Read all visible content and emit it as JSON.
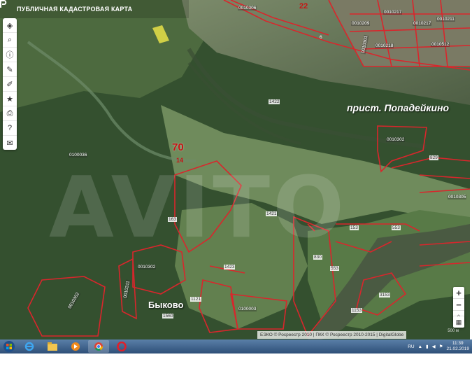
{
  "app": {
    "title": "ПУБЛИЧНАЯ КАДАСТРОВАЯ КАРТА"
  },
  "toolbar": {
    "tools": [
      {
        "name": "layers-icon",
        "glyph": "◈"
      },
      {
        "name": "search-icon",
        "glyph": "⌕"
      },
      {
        "name": "info-icon",
        "glyph": "ⓘ"
      },
      {
        "name": "pencil-icon",
        "glyph": "✎"
      },
      {
        "name": "ruler-icon",
        "glyph": "✐"
      },
      {
        "name": "star-icon",
        "glyph": "★"
      },
      {
        "name": "print-icon",
        "glyph": "⎙"
      },
      {
        "name": "help-icon",
        "glyph": "?"
      },
      {
        "name": "mail-icon",
        "glyph": "✉"
      }
    ]
  },
  "zoom": {
    "in": "+",
    "out": "−",
    "reset": "⌂"
  },
  "map": {
    "labels": {
      "q_top": "0010306",
      "num22": "22",
      "b1": "0010209",
      "b2": "0010217",
      "b3": "0010211",
      "b4": "0010218",
      "b5": "0010512",
      "b6": "0010301",
      "n6": "6",
      "p1422": "1422",
      "pristan": "прист. Попадейкино",
      "d1": "0010302",
      "n829": "829",
      "d_right": "0010305",
      "forest_big": "0100036",
      "num70": "70",
      "num14": "14",
      "n1421": "1421",
      "n163": "163",
      "n1423": "1423",
      "n830": "830",
      "n553": "553",
      "n1_153": "153",
      "n1_553": "553",
      "n3153": "3153",
      "n1153": "1153",
      "v1": "0010302",
      "v2": "0010311",
      "v3": "0010302",
      "bykovo": "Быково",
      "n1560": "1560",
      "n1121": "1121",
      "v4": "0100003"
    },
    "watermark": "AVITO",
    "attribution": "ЕЭКО © Росреестр 2010 | ПКК © Росреестр 2010-2015 | DigitalGlobe",
    "scale": "500 м"
  },
  "taskbar": {
    "lang": "RU",
    "time": "11:39",
    "date": "21.02.2019"
  },
  "colors": {
    "boundary": "#d9262c",
    "river": "#5f6d55",
    "forest": "#2f4a2b",
    "meadow": "#6b8a5a"
  }
}
